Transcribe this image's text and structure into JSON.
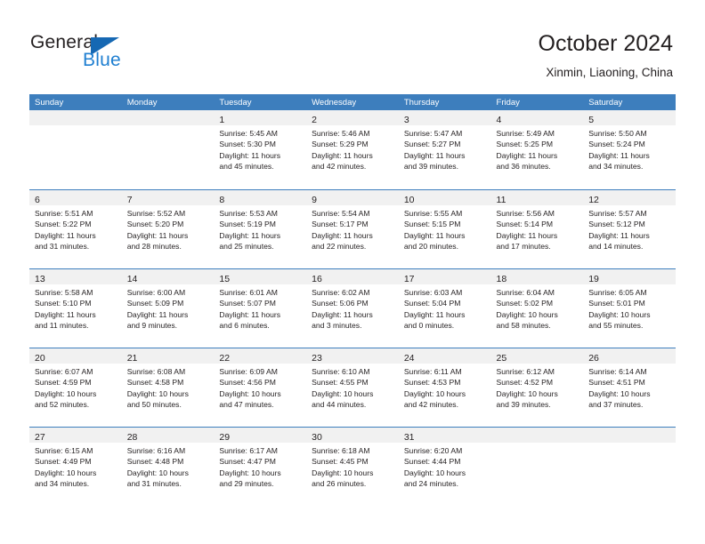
{
  "brand": {
    "name_part1": "General",
    "name_part2": "Blue",
    "triangle_color": "#1668b3",
    "blue_color": "#1f7fd1"
  },
  "header": {
    "title": "October 2024",
    "subtitle": "Xinmin, Liaoning, China"
  },
  "theme": {
    "header_bg": "#3d7ebd",
    "daynum_band_bg": "#f1f1f1",
    "text_color": "#231f20"
  },
  "weekdays": [
    "Sunday",
    "Monday",
    "Tuesday",
    "Wednesday",
    "Thursday",
    "Friday",
    "Saturday"
  ],
  "weeks": [
    [
      {
        "day": "",
        "sunrise": "",
        "sunset": "",
        "daylight_line1": "",
        "daylight_line2": ""
      },
      {
        "day": "",
        "sunrise": "",
        "sunset": "",
        "daylight_line1": "",
        "daylight_line2": ""
      },
      {
        "day": "1",
        "sunrise": "Sunrise: 5:45 AM",
        "sunset": "Sunset: 5:30 PM",
        "daylight_line1": "Daylight: 11 hours",
        "daylight_line2": "and 45 minutes."
      },
      {
        "day": "2",
        "sunrise": "Sunrise: 5:46 AM",
        "sunset": "Sunset: 5:29 PM",
        "daylight_line1": "Daylight: 11 hours",
        "daylight_line2": "and 42 minutes."
      },
      {
        "day": "3",
        "sunrise": "Sunrise: 5:47 AM",
        "sunset": "Sunset: 5:27 PM",
        "daylight_line1": "Daylight: 11 hours",
        "daylight_line2": "and 39 minutes."
      },
      {
        "day": "4",
        "sunrise": "Sunrise: 5:49 AM",
        "sunset": "Sunset: 5:25 PM",
        "daylight_line1": "Daylight: 11 hours",
        "daylight_line2": "and 36 minutes."
      },
      {
        "day": "5",
        "sunrise": "Sunrise: 5:50 AM",
        "sunset": "Sunset: 5:24 PM",
        "daylight_line1": "Daylight: 11 hours",
        "daylight_line2": "and 34 minutes."
      }
    ],
    [
      {
        "day": "6",
        "sunrise": "Sunrise: 5:51 AM",
        "sunset": "Sunset: 5:22 PM",
        "daylight_line1": "Daylight: 11 hours",
        "daylight_line2": "and 31 minutes."
      },
      {
        "day": "7",
        "sunrise": "Sunrise: 5:52 AM",
        "sunset": "Sunset: 5:20 PM",
        "daylight_line1": "Daylight: 11 hours",
        "daylight_line2": "and 28 minutes."
      },
      {
        "day": "8",
        "sunrise": "Sunrise: 5:53 AM",
        "sunset": "Sunset: 5:19 PM",
        "daylight_line1": "Daylight: 11 hours",
        "daylight_line2": "and 25 minutes."
      },
      {
        "day": "9",
        "sunrise": "Sunrise: 5:54 AM",
        "sunset": "Sunset: 5:17 PM",
        "daylight_line1": "Daylight: 11 hours",
        "daylight_line2": "and 22 minutes."
      },
      {
        "day": "10",
        "sunrise": "Sunrise: 5:55 AM",
        "sunset": "Sunset: 5:15 PM",
        "daylight_line1": "Daylight: 11 hours",
        "daylight_line2": "and 20 minutes."
      },
      {
        "day": "11",
        "sunrise": "Sunrise: 5:56 AM",
        "sunset": "Sunset: 5:14 PM",
        "daylight_line1": "Daylight: 11 hours",
        "daylight_line2": "and 17 minutes."
      },
      {
        "day": "12",
        "sunrise": "Sunrise: 5:57 AM",
        "sunset": "Sunset: 5:12 PM",
        "daylight_line1": "Daylight: 11 hours",
        "daylight_line2": "and 14 minutes."
      }
    ],
    [
      {
        "day": "13",
        "sunrise": "Sunrise: 5:58 AM",
        "sunset": "Sunset: 5:10 PM",
        "daylight_line1": "Daylight: 11 hours",
        "daylight_line2": "and 11 minutes."
      },
      {
        "day": "14",
        "sunrise": "Sunrise: 6:00 AM",
        "sunset": "Sunset: 5:09 PM",
        "daylight_line1": "Daylight: 11 hours",
        "daylight_line2": "and 9 minutes."
      },
      {
        "day": "15",
        "sunrise": "Sunrise: 6:01 AM",
        "sunset": "Sunset: 5:07 PM",
        "daylight_line1": "Daylight: 11 hours",
        "daylight_line2": "and 6 minutes."
      },
      {
        "day": "16",
        "sunrise": "Sunrise: 6:02 AM",
        "sunset": "Sunset: 5:06 PM",
        "daylight_line1": "Daylight: 11 hours",
        "daylight_line2": "and 3 minutes."
      },
      {
        "day": "17",
        "sunrise": "Sunrise: 6:03 AM",
        "sunset": "Sunset: 5:04 PM",
        "daylight_line1": "Daylight: 11 hours",
        "daylight_line2": "and 0 minutes."
      },
      {
        "day": "18",
        "sunrise": "Sunrise: 6:04 AM",
        "sunset": "Sunset: 5:02 PM",
        "daylight_line1": "Daylight: 10 hours",
        "daylight_line2": "and 58 minutes."
      },
      {
        "day": "19",
        "sunrise": "Sunrise: 6:05 AM",
        "sunset": "Sunset: 5:01 PM",
        "daylight_line1": "Daylight: 10 hours",
        "daylight_line2": "and 55 minutes."
      }
    ],
    [
      {
        "day": "20",
        "sunrise": "Sunrise: 6:07 AM",
        "sunset": "Sunset: 4:59 PM",
        "daylight_line1": "Daylight: 10 hours",
        "daylight_line2": "and 52 minutes."
      },
      {
        "day": "21",
        "sunrise": "Sunrise: 6:08 AM",
        "sunset": "Sunset: 4:58 PM",
        "daylight_line1": "Daylight: 10 hours",
        "daylight_line2": "and 50 minutes."
      },
      {
        "day": "22",
        "sunrise": "Sunrise: 6:09 AM",
        "sunset": "Sunset: 4:56 PM",
        "daylight_line1": "Daylight: 10 hours",
        "daylight_line2": "and 47 minutes."
      },
      {
        "day": "23",
        "sunrise": "Sunrise: 6:10 AM",
        "sunset": "Sunset: 4:55 PM",
        "daylight_line1": "Daylight: 10 hours",
        "daylight_line2": "and 44 minutes."
      },
      {
        "day": "24",
        "sunrise": "Sunrise: 6:11 AM",
        "sunset": "Sunset: 4:53 PM",
        "daylight_line1": "Daylight: 10 hours",
        "daylight_line2": "and 42 minutes."
      },
      {
        "day": "25",
        "sunrise": "Sunrise: 6:12 AM",
        "sunset": "Sunset: 4:52 PM",
        "daylight_line1": "Daylight: 10 hours",
        "daylight_line2": "and 39 minutes."
      },
      {
        "day": "26",
        "sunrise": "Sunrise: 6:14 AM",
        "sunset": "Sunset: 4:51 PM",
        "daylight_line1": "Daylight: 10 hours",
        "daylight_line2": "and 37 minutes."
      }
    ],
    [
      {
        "day": "27",
        "sunrise": "Sunrise: 6:15 AM",
        "sunset": "Sunset: 4:49 PM",
        "daylight_line1": "Daylight: 10 hours",
        "daylight_line2": "and 34 minutes."
      },
      {
        "day": "28",
        "sunrise": "Sunrise: 6:16 AM",
        "sunset": "Sunset: 4:48 PM",
        "daylight_line1": "Daylight: 10 hours",
        "daylight_line2": "and 31 minutes."
      },
      {
        "day": "29",
        "sunrise": "Sunrise: 6:17 AM",
        "sunset": "Sunset: 4:47 PM",
        "daylight_line1": "Daylight: 10 hours",
        "daylight_line2": "and 29 minutes."
      },
      {
        "day": "30",
        "sunrise": "Sunrise: 6:18 AM",
        "sunset": "Sunset: 4:45 PM",
        "daylight_line1": "Daylight: 10 hours",
        "daylight_line2": "and 26 minutes."
      },
      {
        "day": "31",
        "sunrise": "Sunrise: 6:20 AM",
        "sunset": "Sunset: 4:44 PM",
        "daylight_line1": "Daylight: 10 hours",
        "daylight_line2": "and 24 minutes."
      },
      {
        "day": "",
        "sunrise": "",
        "sunset": "",
        "daylight_line1": "",
        "daylight_line2": ""
      },
      {
        "day": "",
        "sunrise": "",
        "sunset": "",
        "daylight_line1": "",
        "daylight_line2": ""
      }
    ]
  ]
}
